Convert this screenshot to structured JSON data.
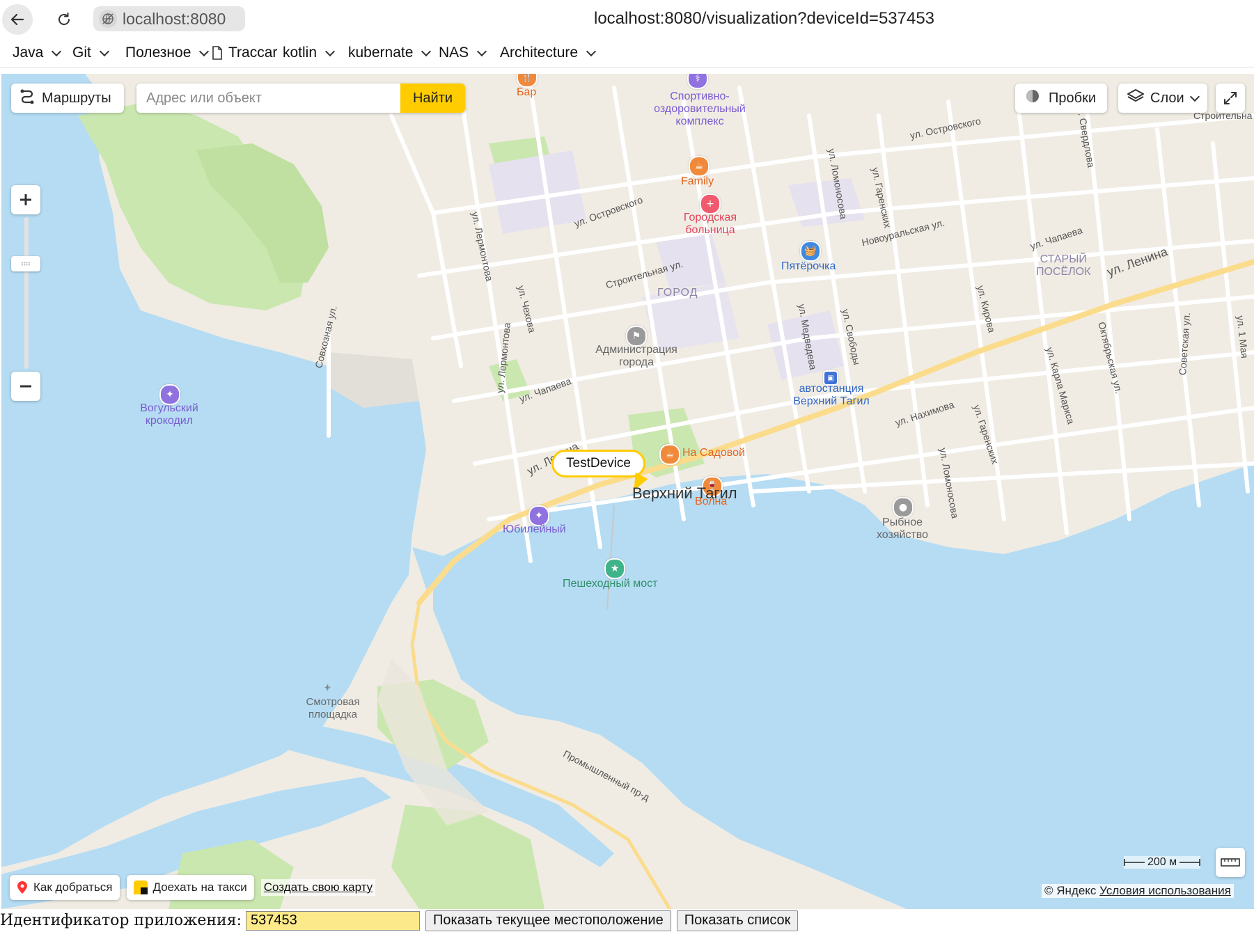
{
  "browser": {
    "origin": "localhost:8080",
    "url": "localhost:8080/visualization?deviceId=537453",
    "bookmarks": [
      {
        "label": "Java",
        "folder": true
      },
      {
        "label": "Git",
        "folder": true
      },
      {
        "label": "Полезное",
        "folder": true
      },
      {
        "label": "Traccar",
        "folder": false
      },
      {
        "label": "kotlin",
        "folder": true
      },
      {
        "label": "kubernate",
        "folder": true
      },
      {
        "label": "NAS",
        "folder": true
      },
      {
        "label": "Architecture",
        "folder": true
      }
    ]
  },
  "map": {
    "routes_label": "Маршруты",
    "search_placeholder": "Адрес или объект",
    "search_button": "Найти",
    "traffic_label": "Пробки",
    "layers_label": "Слои",
    "placemark_label": "TestDevice",
    "city_name": "Верхний Тагил",
    "streets": {
      "lenina_1": "ул. Ленина",
      "lenina_2": "ул. Ленина",
      "ostrovskogo_1": "ул. Островского",
      "ostrovskogo_2": "ул. Островского",
      "stroitelnaya_1": "Строительная ул.",
      "stroitelnaya_2": "Строительна",
      "sverdlova": "ул. Свердлова",
      "lomonosova_1": "ул. Ломоносова",
      "lomonosova_2": "ул. Ломоносова",
      "garenskikh_1": "ул. Гаренских",
      "garenskikh_2": "ул. Гаренских",
      "lermontova_1": "ул. Лермонтова",
      "lermontova_2": "ул. Лермонтова",
      "chekhova": "ул. Чехова",
      "novouralskaya": "Новоуральская ул.",
      "chapaeva_1": "ул. Чапаева",
      "chapaeva_2": "ул. Чапаева",
      "medvedeva": "ул. Медведева",
      "svobody": "ул. Свободы",
      "kirova": "ул. Кирова",
      "karla_marksa": "ул. Карла Маркса",
      "oktyabrskaya": "Октябрьская ул.",
      "sovetskaya": "Советская ул.",
      "pervogo_maya": "ул. 1 Мая",
      "nakhimova": "ул. Нахимова",
      "sovkhoznaya": "Совхозная ул.",
      "promyshlenny": "Промышленный пр-д"
    },
    "districts": {
      "gorod": "ГОРОД",
      "stary_posyolok": "СТАРЫЙ\nПОСЁЛОК"
    },
    "pois": {
      "bar": "Бар",
      "sport": "Спортивно-\nоздоровительный\nкомплекс",
      "family": "Family",
      "hospital": "Городская\nбольница",
      "pyaterochka": "Пятёрочка",
      "admin": "Администрация\nгорода",
      "bus_station": "автостанция\nВерхний Тагил",
      "vogulsky": "Вогульский\nкрокодил",
      "na_sadovoy": "На Садовой",
      "volna": "Волна",
      "yubileyny": "Юбилейный",
      "bridge": "Пешеходный мост",
      "fish": "Рыбное\nхозяйство",
      "viewpoint": "Смотровая\nплощадка"
    },
    "bottom": {
      "directions": "Как добраться",
      "taxi": "Доехать на такси",
      "create_map": "Создать свою карту",
      "scale": "200 м",
      "copyright_prefix": "© Яндекс",
      "terms": "Условия использования"
    },
    "colors": {
      "water": "#b5dcf3",
      "land": "#f0ece4",
      "park": "#cbe7b0",
      "road_main": "#fbdc8c",
      "accent": "#ffcc00"
    }
  },
  "form": {
    "label": "Идентификатор приложения:",
    "app_id": "537453",
    "show_location_button": "Показать текущее местоположение",
    "show_list_button": "Показать список"
  }
}
